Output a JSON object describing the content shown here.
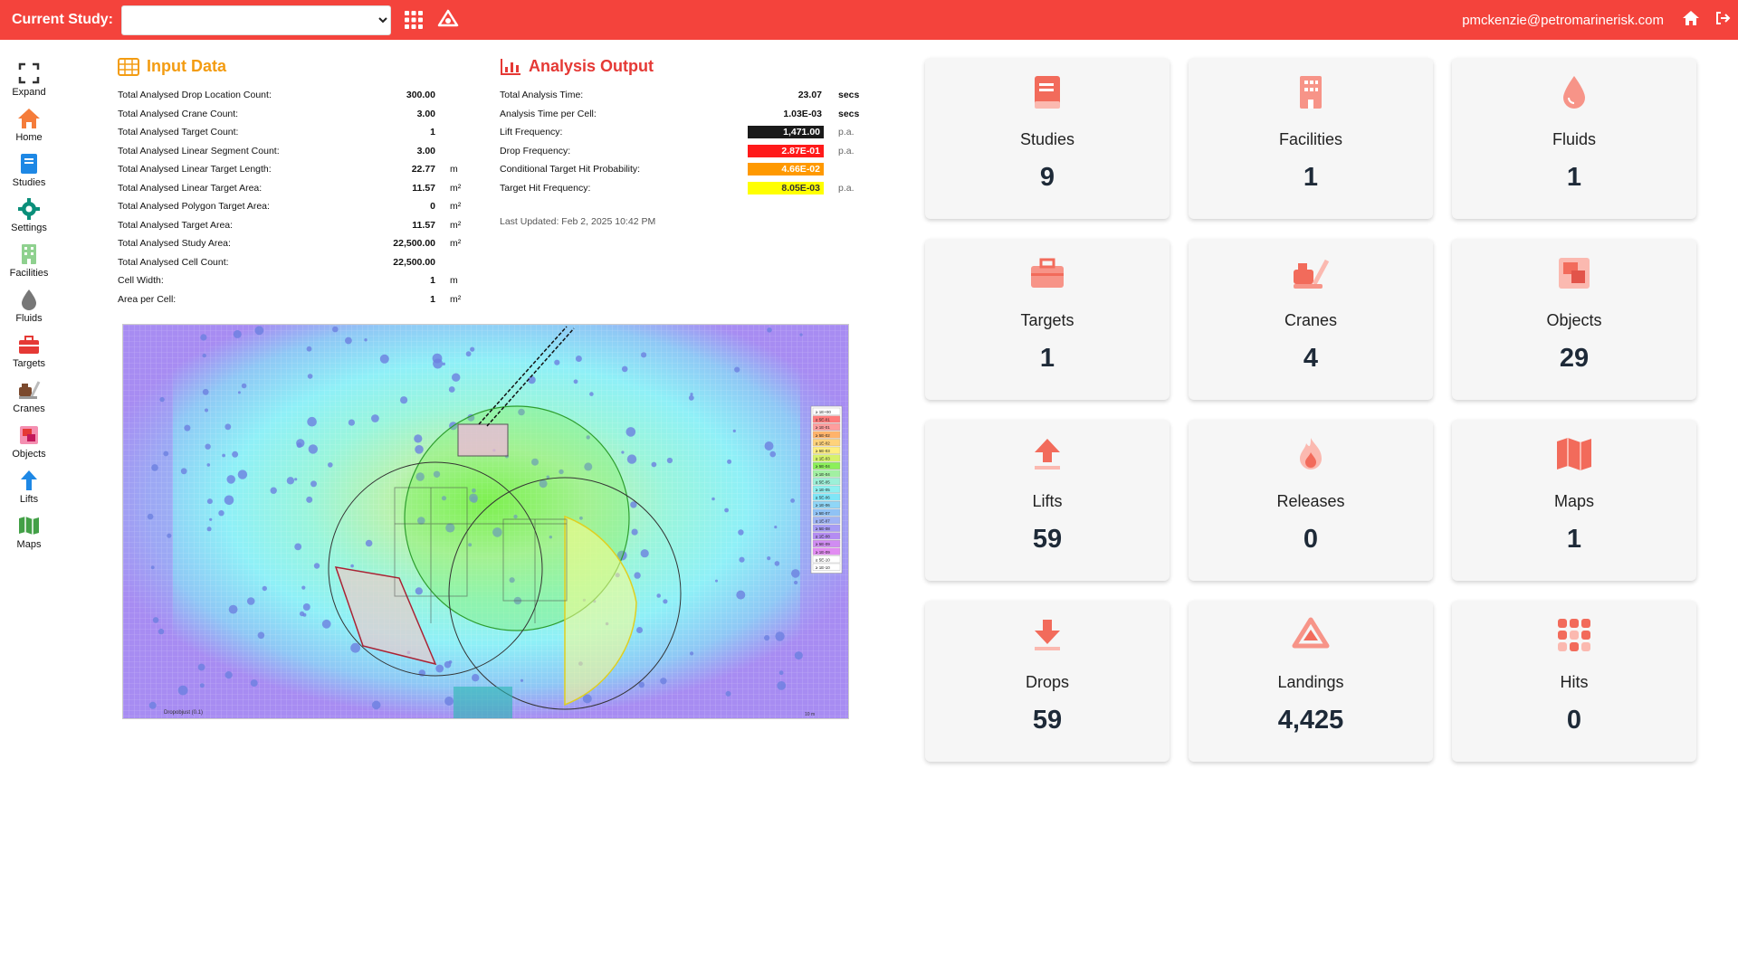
{
  "topbar": {
    "study_label": "Current Study:",
    "study_value": "",
    "email": "pmckenzie@petromarinerisk.com"
  },
  "sidebar": {
    "items": [
      {
        "label": "Expand",
        "icon": "expand-icon"
      },
      {
        "label": "Home",
        "icon": "home-icon"
      },
      {
        "label": "Studies",
        "icon": "book-icon"
      },
      {
        "label": "Settings",
        "icon": "gear-icon"
      },
      {
        "label": "Facilities",
        "icon": "building-icon"
      },
      {
        "label": "Fluids",
        "icon": "droplet-icon"
      },
      {
        "label": "Targets",
        "icon": "toolbox-icon"
      },
      {
        "label": "Cranes",
        "icon": "crane-icon"
      },
      {
        "label": "Objects",
        "icon": "objects-icon"
      },
      {
        "label": "Lifts",
        "icon": "arrow-up-icon"
      },
      {
        "label": "Maps",
        "icon": "map-icon"
      }
    ]
  },
  "input_data": {
    "title": "Input Data",
    "rows": [
      {
        "label": "Total Analysed Drop Location Count:",
        "value": "300.00",
        "unit": ""
      },
      {
        "label": "Total Analysed Crane Count:",
        "value": "3.00",
        "unit": ""
      },
      {
        "label": "Total Analysed Target Count:",
        "value": "1",
        "unit": ""
      },
      {
        "label": "Total Analysed Linear Segment Count:",
        "value": "3.00",
        "unit": ""
      },
      {
        "label": "Total Analysed Linear Target Length:",
        "value": "22.77",
        "unit": "m"
      },
      {
        "label": "Total Analysed Linear Target Area:",
        "value": "11.57",
        "unit": "m²"
      },
      {
        "label": "Total Analysed Polygon Target Area:",
        "value": "0",
        "unit": "m²"
      },
      {
        "label": "Total Analysed Target Area:",
        "value": "11.57",
        "unit": "m²"
      },
      {
        "label": "Total Analysed Study Area:",
        "value": "22,500.00",
        "unit": "m²"
      },
      {
        "label": "Total Analysed Cell Count:",
        "value": "22,500.00",
        "unit": ""
      },
      {
        "label": "Cell Width:",
        "value": "1",
        "unit": "m"
      },
      {
        "label": "Area per Cell:",
        "value": "1",
        "unit": "m²"
      }
    ]
  },
  "analysis_output": {
    "title": "Analysis Output",
    "rows": [
      {
        "label": "Total Analysis Time:",
        "value": "23.07",
        "unit": "secs",
        "bg": "",
        "fg": "#111111"
      },
      {
        "label": "Analysis Time per Cell:",
        "value": "1.03E-03",
        "unit": "secs",
        "bg": "",
        "fg": "#111111"
      },
      {
        "label": "Lift Frequency:",
        "value": "1,471.00",
        "unit": "p.a.",
        "bg": "#1a1a1a",
        "fg": "#ffffff"
      },
      {
        "label": "Drop Frequency:",
        "value": "2.87E-01",
        "unit": "p.a.",
        "bg": "#ff1a1a",
        "fg": "#ffffff"
      },
      {
        "label": "Conditional Target Hit Probability:",
        "value": "4.66E-02",
        "unit": "",
        "bg": "#ff9900",
        "fg": "#ffffff"
      },
      {
        "label": "Target Hit Frequency:",
        "value": "8.05E-03",
        "unit": "p.a.",
        "bg": "#ffff00",
        "fg": "#333333"
      }
    ],
    "last_updated": "Last Updated: Feb 2, 2025 10:42 PM"
  },
  "map": {
    "legend": [
      "≥ 1E+00",
      "≥ 5E-01",
      "≥ 1E-01",
      "≥ 5E-02",
      "≥ 1E-02",
      "≥ 5E-03",
      "≥ 1E-03",
      "≥ 5E-04",
      "≥ 1E-04",
      "≥ 5E-05",
      "≥ 1E-05",
      "≥ 5E-06",
      "≥ 1E-06",
      "≥ 5E-07",
      "≥ 1E-07",
      "≥ 5E-08",
      "≥ 1E-08",
      "≥ 5E-09",
      "≥ 1E-09",
      "≥ 5E-10",
      "≥ 1E-10"
    ],
    "footer_label": "Dropobjust (0.1)",
    "scale_label": "10 m"
  },
  "cards": [
    {
      "label": "Studies",
      "value": "9",
      "icon": "book-icon"
    },
    {
      "label": "Facilities",
      "value": "1",
      "icon": "building-icon"
    },
    {
      "label": "Fluids",
      "value": "1",
      "icon": "droplet-icon"
    },
    {
      "label": "Targets",
      "value": "1",
      "icon": "toolbox-icon"
    },
    {
      "label": "Cranes",
      "value": "4",
      "icon": "crane-icon"
    },
    {
      "label": "Objects",
      "value": "29",
      "icon": "objects-icon"
    },
    {
      "label": "Lifts",
      "value": "59",
      "icon": "arrow-up-icon"
    },
    {
      "label": "Releases",
      "value": "0",
      "icon": "flame-icon"
    },
    {
      "label": "Maps",
      "value": "1",
      "icon": "map-icon"
    },
    {
      "label": "Drops",
      "value": "59",
      "icon": "arrow-down-icon"
    },
    {
      "label": "Landings",
      "value": "4,425",
      "icon": "landing-icon"
    },
    {
      "label": "Hits",
      "value": "0",
      "icon": "grid-dots-icon"
    }
  ],
  "colors": {
    "brand": "#f4433c",
    "card_icon": "#f26b5b",
    "input_title": "#f39c12",
    "output_title": "#e53935"
  }
}
